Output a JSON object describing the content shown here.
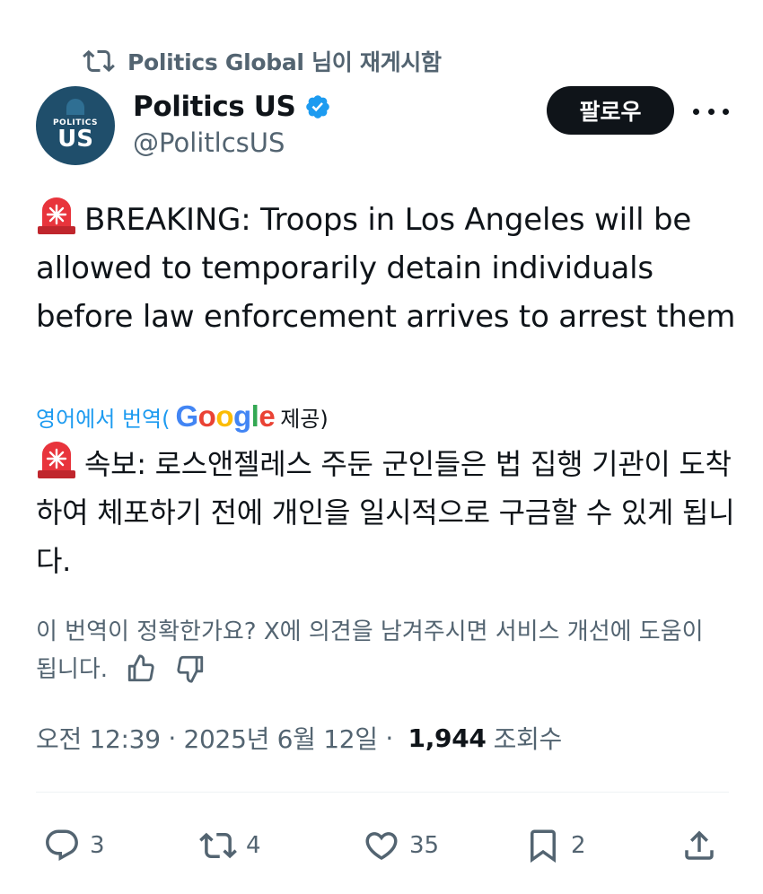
{
  "repost": {
    "icon": "repost-icon",
    "text": "Politics Global 님이 재게시함"
  },
  "author": {
    "avatar_small": "POLITICS",
    "avatar_big": "US",
    "name": "Politics US",
    "verified_icon": "verified-badge-icon",
    "handle": "@PolitlcsUS",
    "follow_label": "팔로우",
    "more_icon": "more-icon"
  },
  "tweet": {
    "emoji": "siren-emoji",
    "text_en": "BREAKING: Troops in Los Angeles will be allowed to temporarily detain individuals before law enforcement arrives to arrest them",
    "translate_prefix": "영어에서 번역(",
    "translate_google": "Google",
    "translate_suffix": " 제공)",
    "text_kr": "속보: 로스앤젤레스 주둔 군인들은 법 집행 기관이 도착하여 체포하기 전에 개인을 일시적으로 구금할 수 있게 됩니다.",
    "feedback": "이 번역이 정확한가요? X에 의견을 남겨주시면 서비스 개선에 도움이 됩니다."
  },
  "meta": {
    "time": "오전 12:39",
    "separator": " · ",
    "date": "2025년 6월 12일",
    "separator2": " · ",
    "views": "1,944",
    "views_label": "조회수"
  },
  "actions": {
    "replies": "3",
    "reposts": "4",
    "likes": "35",
    "bookmarks": "2"
  },
  "colors": {
    "accent": "#1d9bf0",
    "muted": "#536471",
    "text": "#0f1419",
    "verified": "#1d9bf0"
  }
}
